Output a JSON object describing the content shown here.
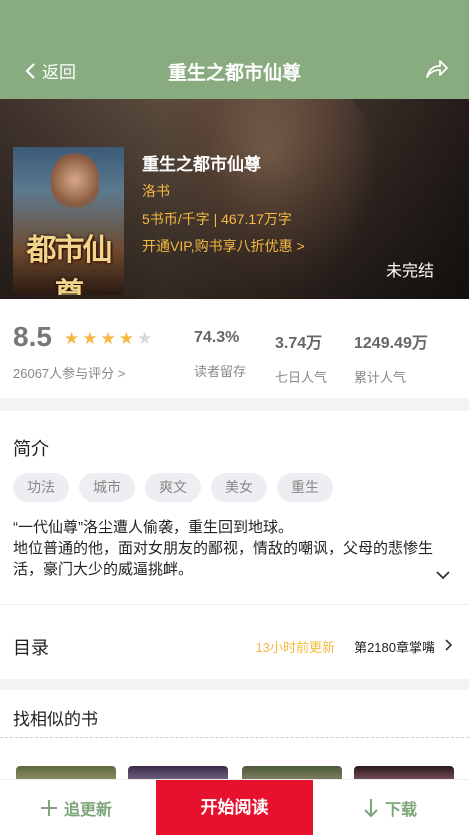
{
  "header": {
    "back_label": "返回",
    "title": "重生之都市仙尊"
  },
  "book": {
    "name": "重生之都市仙尊",
    "author": "洛书",
    "price": "5书币/千字 | 467.17万字",
    "vip_promo": "开通VIP,购书享八折优惠 >",
    "status": "未完结",
    "cover_title": "都市仙尊"
  },
  "rating": {
    "score": "8.5",
    "stars_filled": 4,
    "stars_total": 5,
    "raters": "26067人参与评分 >"
  },
  "stats": [
    {
      "value": "74.3%",
      "label": "读者留存"
    },
    {
      "value": "3.74万",
      "label": "七日人气"
    },
    {
      "value": "1249.49万",
      "label": "累计人气"
    }
  ],
  "intro": {
    "title": "简介",
    "tags": [
      "功法",
      "城市",
      "爽文",
      "美女",
      "重生"
    ],
    "description": "“一代仙尊”洛尘遭人偷袭，重生回到地球。\n地位普通的他，面对女朋友的鄙视，情敌的嘲讽，父母的悲惨生活，豪门大少的威逼挑衅。"
  },
  "toc": {
    "title": "目录",
    "update": "13小时前更新",
    "chapter": "第2180章掌嘴"
  },
  "similar": {
    "title": "找相似的书"
  },
  "bottom": {
    "follow_label": "追更新",
    "read_label": "开始阅读",
    "download_label": "下载"
  },
  "colors": {
    "header_bg": "#88ab7f",
    "accent_gold": "#f5b942",
    "read_button": "#e8112d",
    "action_green": "#7ea57a",
    "star_filled": "#f5b942",
    "star_empty": "#d8d8d8"
  },
  "icons": [
    "chevron-left-icon",
    "share-icon",
    "star-icon",
    "chevron-down-icon",
    "chevron-right-icon",
    "plus-icon",
    "arrow-down-icon"
  ]
}
